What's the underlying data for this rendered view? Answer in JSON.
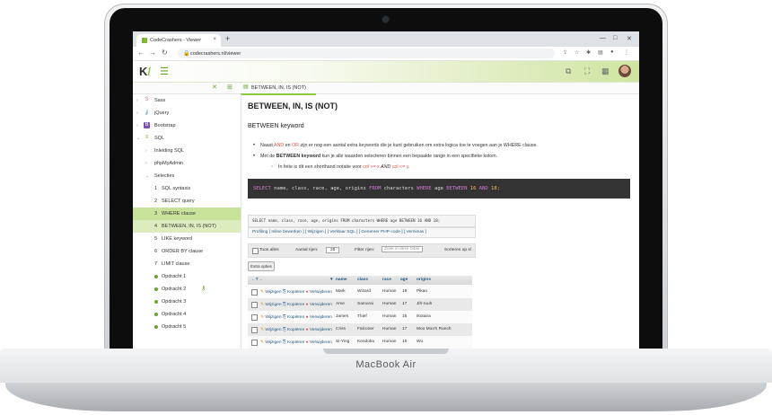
{
  "device": {
    "brand_label": "MacBook Air"
  },
  "browser": {
    "tab_title": "CodeCrashers - Viewer",
    "url": "codecrashers.nl/viewer"
  },
  "doc_tab": {
    "label": "BETWEEN, IN, IS (NOT)"
  },
  "sidebar": {
    "items": [
      {
        "label": "Sass",
        "icon": "sass-icon"
      },
      {
        "label": "jQuery",
        "icon": "jquery-icon"
      },
      {
        "label": "Bootstrap",
        "icon": "bootstrap-icon"
      },
      {
        "label": "SQL",
        "icon": "database-icon"
      }
    ],
    "sub_items": [
      "Inleiding SQL",
      "phpMyAdmin",
      "Selecties"
    ],
    "lessons": [
      {
        "num": "1",
        "label": "SQL syntaxis"
      },
      {
        "num": "2",
        "label": "SELECT query"
      },
      {
        "num": "3",
        "label": "WHERE clause"
      },
      {
        "num": "4",
        "label": "BETWEEN, IN, IS (NOT)"
      },
      {
        "num": "5",
        "label": "LIKE keyword"
      },
      {
        "num": "6",
        "label": "ORDER BY clause"
      },
      {
        "num": "7",
        "label": "LIMIT clause"
      }
    ],
    "assignments": [
      "Opdracht 1",
      "Opdracht 2",
      "Opdracht 3",
      "Opdracht 4",
      "Opdracht 5"
    ]
  },
  "content": {
    "title": "BETWEEN, IN, IS (NOT)",
    "subtitle": "BETWEEN keyword",
    "bullet1": {
      "pre": "Naast ",
      "kw1": "AND",
      "mid": " en ",
      "kw2": "OR",
      "post": " zijn er nog een aantal extra keywords die je kunt gebruiken om extra logica toe te voegen aan je WHERE clause."
    },
    "bullet2": {
      "pre": "Met de ",
      "kw": "BETWEEN keyword",
      "post": " kun je alle waarden selecteren binnen een bepaalde range in een specifieke kolom."
    },
    "bullet3": {
      "pre": "In feite is dit een shorthand notatie voor ",
      "code1": "col >= x",
      "mid": " AND ",
      "code2": "col <= y",
      "post": "."
    },
    "code": {
      "p1": "SELECT",
      "p2": " name, class, race, age, origins ",
      "p3": "FROM",
      "p4": " characters ",
      "p5": "WHERE",
      "p6": " age ",
      "p7": "BETWEEN",
      "p8": " 16 ",
      "p9": "AND",
      "p10": " 18;"
    }
  },
  "pma": {
    "query": "SELECT name, class, race, age, origins FROM characters WHERE age BETWEEN 16 AND 18;",
    "toolbar": "Profiling [ Inline bewerken ] [ Wijzigen ] [ Verklaar SQL ] [ Genereer PHP-code ] [ Vernieuw ]",
    "show_all": "Toon alles",
    "rows_label": "Aantal rijen:",
    "rows_value": "25",
    "filter_label": "Filter rijen:",
    "filter_placeholder": "Zoek in deze tabel",
    "sort_label": "Sorteren op sl",
    "extra_button": "Extra opties",
    "columns": [
      "name",
      "class",
      "race",
      "age",
      "origins"
    ],
    "action_edit": "Wijzigen",
    "action_copy": "Kopiëren",
    "action_delete": "Verwijderen",
    "rows": [
      {
        "name": "Mark",
        "class": "Wizard",
        "race": "Human",
        "age": "18",
        "origins": "Pikao"
      },
      {
        "name": "Ame",
        "class": "Samurai",
        "race": "Human",
        "age": "17",
        "origins": "Jih-ruuh"
      },
      {
        "name": "James",
        "class": "Thief",
        "race": "Human",
        "age": "16",
        "origins": "Ikotaira"
      },
      {
        "name": "Criss",
        "class": "Falconer",
        "race": "Human",
        "age": "17",
        "origins": "Moo Moo's Ranch"
      },
      {
        "name": "Si-Ying",
        "class": "Kendoka",
        "race": "Human",
        "age": "16",
        "origins": "Wu"
      }
    ]
  }
}
